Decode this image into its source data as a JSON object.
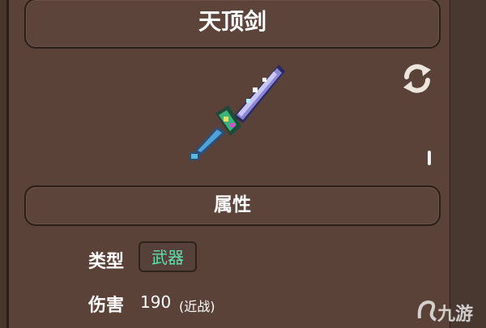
{
  "item": {
    "name": "天顶剑",
    "art_icon": "zenith-sword-icon"
  },
  "section": {
    "attributes_label": "属性"
  },
  "properties": {
    "type_label": "类型",
    "type_value": "武器",
    "damage_label": "伤害",
    "damage_value": "190",
    "damage_note": "(近战)"
  },
  "controls": {
    "refresh_icon": "refresh-icon"
  },
  "watermark": {
    "text": "九游"
  },
  "colors": {
    "panel": "#5a4238",
    "border": "#2a1e18",
    "badge_text": "#5fe0b0",
    "text": "#ffffff"
  }
}
